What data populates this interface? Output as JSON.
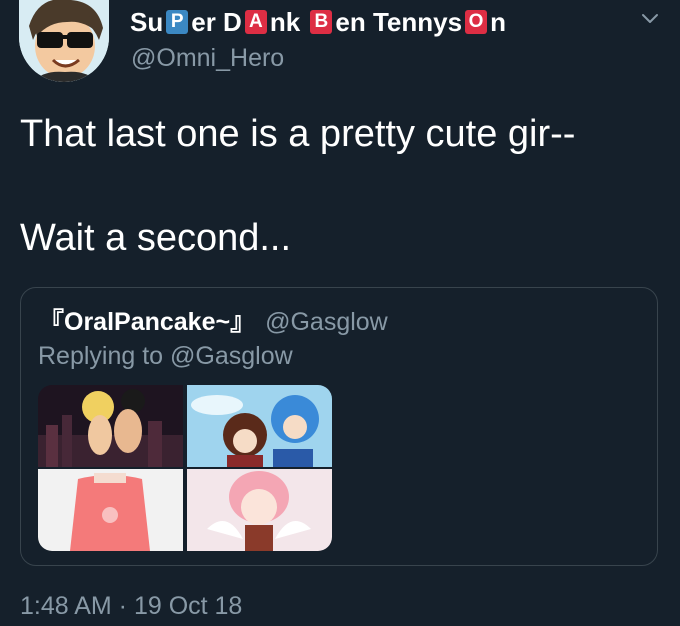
{
  "author": {
    "name_parts": [
      {
        "kind": "text",
        "value": "Su"
      },
      {
        "kind": "badge",
        "value": "P",
        "color": "#3b88c3"
      },
      {
        "kind": "text",
        "value": "er D"
      },
      {
        "kind": "badge",
        "value": "A",
        "color": "#dd2e44"
      },
      {
        "kind": "text",
        "value": "nk "
      },
      {
        "kind": "badge",
        "value": "B",
        "color": "#dd2e44"
      },
      {
        "kind": "text",
        "value": "en Tennys"
      },
      {
        "kind": "badge",
        "value": "O",
        "color": "#dd2e44"
      },
      {
        "kind": "text",
        "value": "n"
      }
    ],
    "handle": "@Omni_Hero",
    "avatar_icon": "cartoon-avatar-sunglasses"
  },
  "menu_icon": "chevron-down-icon",
  "tweet": {
    "line1": "That last one is a pretty cute gir--",
    "line2": "Wait a second..."
  },
  "quoted": {
    "name": "『OralPancake~』",
    "handle": "@Gasglow",
    "reply_context": "Replying to @Gasglow",
    "images": [
      "anime-girl-swimsuit-night",
      "anime-characters-blue-sky",
      "girl-pink-shirt",
      "pink-hair-anime-character"
    ]
  },
  "timestamp": "1:48 AM · 19 Oct 18",
  "colors": {
    "background": "#15202b",
    "secondary_text": "#8899a6",
    "border": "#38444d"
  }
}
